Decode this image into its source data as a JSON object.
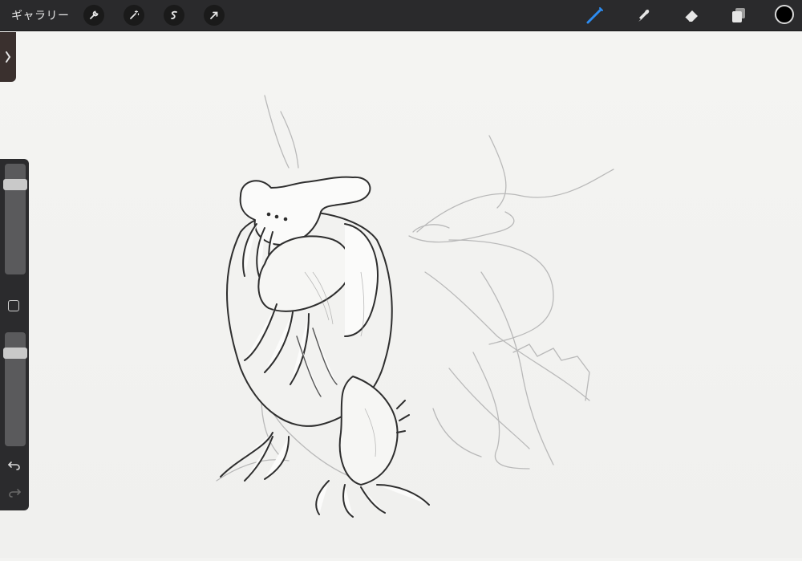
{
  "topbar": {
    "gallery_label": "ギャラリー",
    "left_tools": [
      "wrench-icon",
      "magic-wand-icon",
      "selection-icon",
      "transform-arrow-icon"
    ],
    "right_tools": [
      "brush-icon",
      "smudge-icon",
      "eraser-icon",
      "layers-icon"
    ],
    "active_tool": "brush-icon",
    "accent_color": "#2d8cf0",
    "current_color": "#000000"
  },
  "sidebar": {
    "brush_size_level": 0.85,
    "opacity_level": 0.85
  }
}
